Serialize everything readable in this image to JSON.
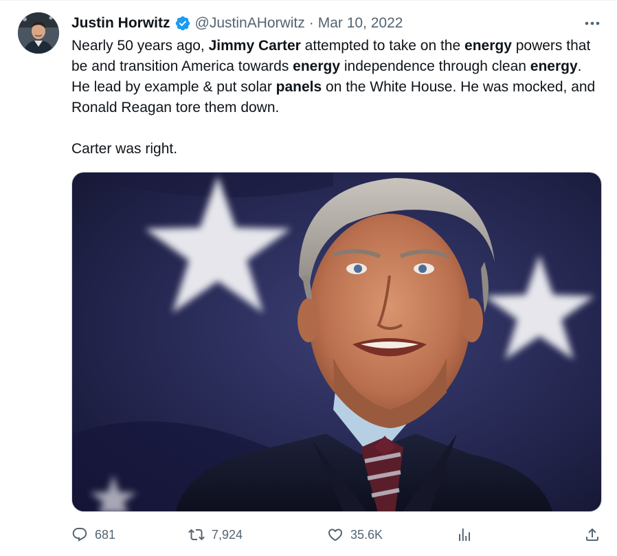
{
  "tweet": {
    "author_name": "Justin Horwitz",
    "handle": "@JustinAHorwitz",
    "separator": "·",
    "date": "Mar 10, 2022",
    "verified_icon": "verified-badge-icon",
    "more_icon": "more-options-icon",
    "text": {
      "s1": "Nearly 50 years ago, ",
      "b1": "Jimmy Carter",
      "s2": " attempted to take on the ",
      "b2": "energy",
      "s3": " powers that be and transition America towards ",
      "b3": "energy",
      "s4": " independence through clean ",
      "b4": "energy",
      "s5": ". He lead by example & put solar ",
      "b5": "panels",
      "s6": " on the White House. He was mocked, and Ronald Reagan tore them down.",
      "p2": "Carter was right."
    },
    "media": {
      "kind": "photo",
      "subject": "portrait in front of flag with stars"
    },
    "actions": {
      "replies": "681",
      "retweets": "7,924",
      "likes": "35.6K",
      "reply_icon": "reply-icon",
      "retweet_icon": "retweet-icon",
      "like_icon": "heart-icon",
      "views_icon": "views-icon",
      "share_icon": "share-icon"
    },
    "colors": {
      "verified": "#1d9bf0",
      "secondary_text": "#536471",
      "primary_text": "#0f1419"
    }
  }
}
